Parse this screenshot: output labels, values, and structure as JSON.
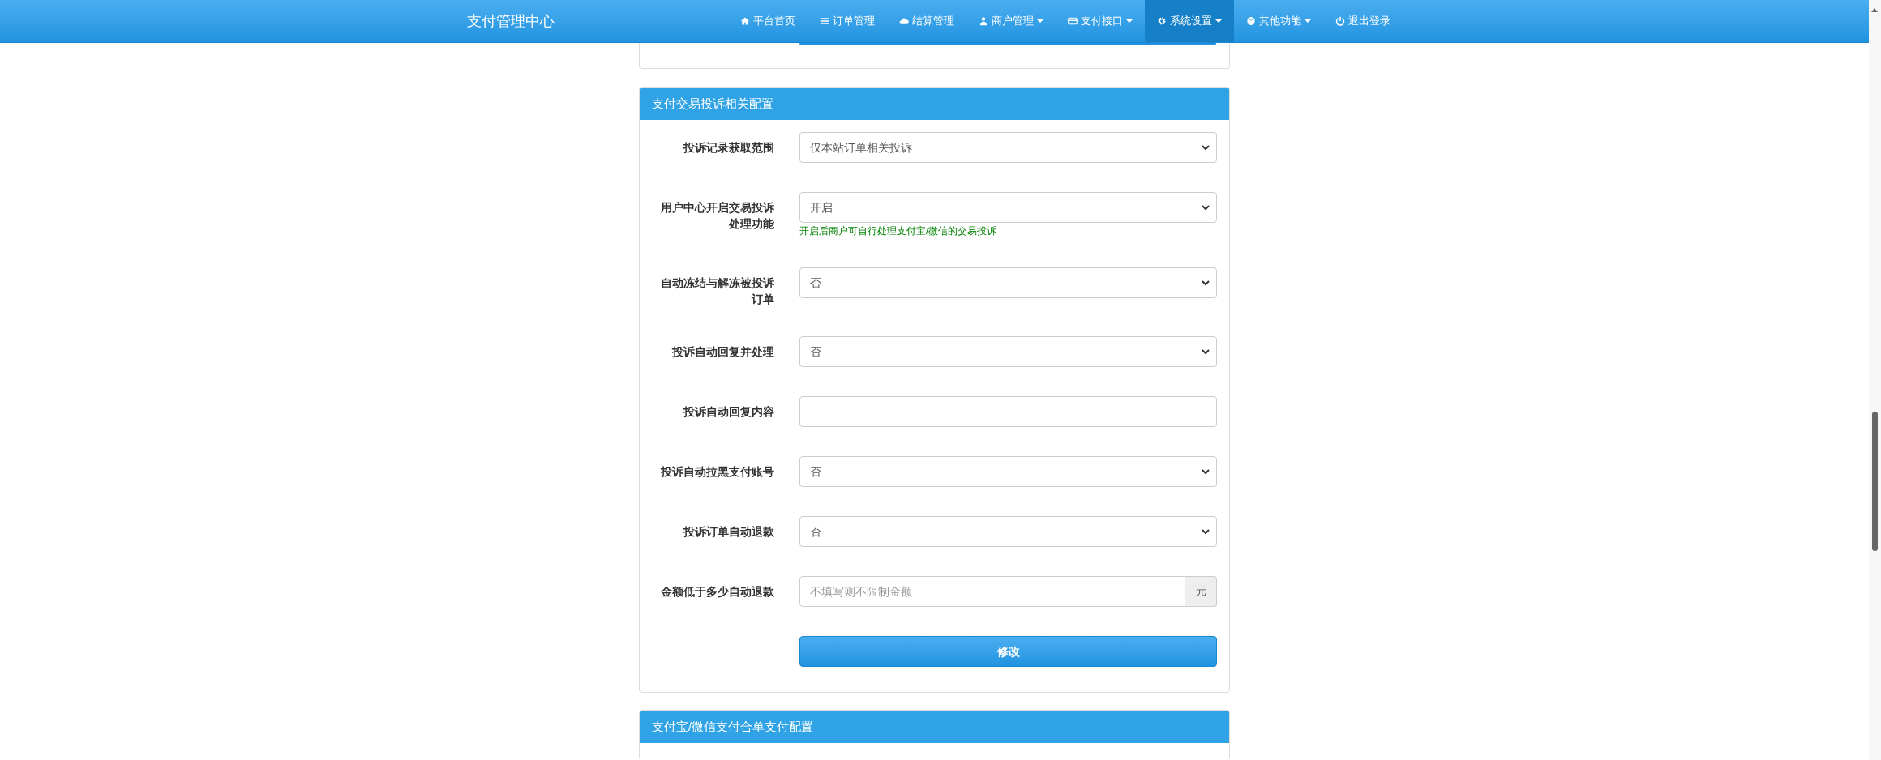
{
  "navbar": {
    "brand": "支付管理中心",
    "items": [
      {
        "label": "平台首页",
        "dropdown": false,
        "selected": false
      },
      {
        "label": "订单管理",
        "dropdown": false,
        "selected": false
      },
      {
        "label": "结算管理",
        "dropdown": false,
        "selected": false
      },
      {
        "label": "商户管理",
        "dropdown": true,
        "selected": false
      },
      {
        "label": "支付接口",
        "dropdown": true,
        "selected": false
      },
      {
        "label": "系统设置",
        "dropdown": true,
        "selected": true
      },
      {
        "label": "其他功能",
        "dropdown": true,
        "selected": false
      },
      {
        "label": "退出登录",
        "dropdown": false,
        "selected": false
      }
    ]
  },
  "panel": {
    "title": "支付交易投诉相关配置",
    "fields": [
      {
        "kind": "select",
        "label": "投诉记录获取范围",
        "value": "仅本站订单相关投诉"
      },
      {
        "kind": "select",
        "label": "用户中心开启交易投诉处理功能",
        "value": "开启",
        "help": "开启后商户可自行处理支付宝/微信的交易投诉"
      },
      {
        "kind": "select",
        "label": "自动冻结与解冻被投诉订单",
        "value": "否"
      },
      {
        "kind": "select",
        "label": "投诉自动回复并处理",
        "value": "否"
      },
      {
        "kind": "text",
        "label": "投诉自动回复内容"
      },
      {
        "kind": "select",
        "label": "投诉自动拉黑支付账号",
        "value": "否"
      },
      {
        "kind": "select",
        "label": "投诉订单自动退款",
        "value": "否"
      },
      {
        "kind": "addon",
        "label": "金额低于多少自动退款",
        "placeholder": "不填写则不限制金额",
        "addon": "元"
      }
    ],
    "submit": "修改"
  },
  "next_panel": {
    "title": "支付宝/微信支付合单支付配置"
  }
}
